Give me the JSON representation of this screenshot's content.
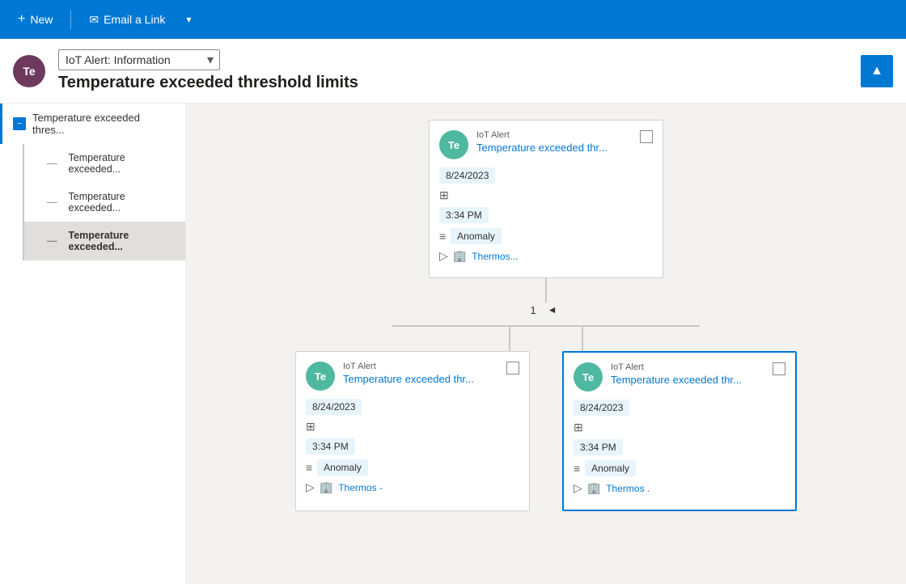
{
  "toolbar": {
    "new_label": "New",
    "email_link_label": "Email a Link",
    "plus_icon": "+",
    "dropdown_arrow": "▾",
    "email_icon": "✉"
  },
  "header": {
    "avatar_initials": "Te",
    "dropdown_value": "IoT Alert: Information",
    "title": "Temperature exceeded threshold limits",
    "collapse_icon": "▲"
  },
  "sidebar": {
    "items": [
      {
        "label": "Temperature exceeded thres...",
        "type": "parent",
        "indent": 0
      },
      {
        "label": "Temperature exceeded...",
        "type": "child",
        "indent": 1
      },
      {
        "label": "Temperature exceeded...",
        "type": "child",
        "indent": 1
      },
      {
        "label": "Temperature exceeded...",
        "type": "child-active",
        "indent": 1
      }
    ]
  },
  "tree": {
    "root_card": {
      "avatar": "Te",
      "type": "IoT Alert",
      "title": "Temperature exceeded thr...",
      "date": "8/24/2023",
      "time": "3:34 PM",
      "tag": "Anomaly",
      "link": "Thermos..."
    },
    "pagination": {
      "page": "1",
      "arrow": "◄"
    },
    "child_cards": [
      {
        "avatar": "Te",
        "type": "IoT Alert",
        "title": "Temperature exceeded thr...",
        "date": "8/24/2023",
        "time": "3:34 PM",
        "tag": "Anomaly",
        "link": "Thermos -",
        "selected": false
      },
      {
        "avatar": "Te",
        "type": "IoT Alert",
        "title": "Temperature exceeded thr...",
        "date": "8/24/2023",
        "time": "3:34 PM",
        "tag": "Anomaly",
        "link": "Thermos .",
        "selected": true
      }
    ]
  }
}
